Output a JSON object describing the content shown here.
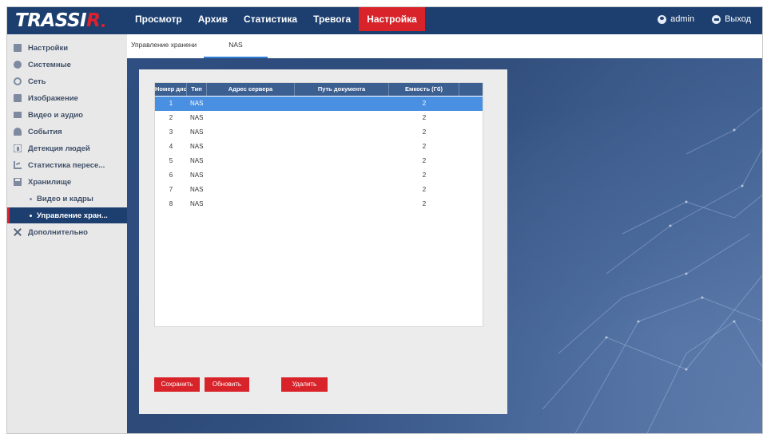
{
  "app": {
    "logo_main": "TRASSI",
    "logo_accent": "R"
  },
  "nav": {
    "items": [
      {
        "label": "Просмотр"
      },
      {
        "label": "Архив"
      },
      {
        "label": "Статистика"
      },
      {
        "label": "Тревога"
      },
      {
        "label": "Настройка",
        "active": true
      }
    ],
    "user": "admin",
    "logout": "Выход"
  },
  "sidebar": {
    "items": [
      {
        "label": "Настройки",
        "icon": "settings-icon"
      },
      {
        "label": "Системные",
        "icon": "system-icon"
      },
      {
        "label": "Сеть",
        "icon": "network-icon"
      },
      {
        "label": "Изображение",
        "icon": "image-icon"
      },
      {
        "label": "Видео и аудио",
        "icon": "video-audio-icon"
      },
      {
        "label": "События",
        "icon": "events-icon"
      },
      {
        "label": "Детекция людей",
        "icon": "people-detection-icon"
      },
      {
        "label": "Статистика пересе...",
        "icon": "statistics-icon"
      },
      {
        "label": "Хранилище",
        "icon": "storage-icon"
      },
      {
        "label": "Видео и кадры",
        "sub": true
      },
      {
        "label": "Управление хран...",
        "sub": true,
        "active": true
      },
      {
        "label": "Дополнительно",
        "icon": "tools-icon"
      }
    ]
  },
  "tabs": [
    {
      "label": "Управление хранени"
    },
    {
      "label": "NAS",
      "active": true
    }
  ],
  "table": {
    "headers": [
      "Номер диска",
      "Тип",
      "Адрес сервера",
      "Путь документа",
      "Емкость (Гб)"
    ],
    "rows": [
      {
        "num": "1",
        "type": "NAS",
        "server": "",
        "path": "",
        "capacity": "2",
        "selected": true
      },
      {
        "num": "2",
        "type": "NAS",
        "server": "",
        "path": "",
        "capacity": "2"
      },
      {
        "num": "3",
        "type": "NAS",
        "server": "",
        "path": "",
        "capacity": "2"
      },
      {
        "num": "4",
        "type": "NAS",
        "server": "",
        "path": "",
        "capacity": "2"
      },
      {
        "num": "5",
        "type": "NAS",
        "server": "",
        "path": "",
        "capacity": "2"
      },
      {
        "num": "6",
        "type": "NAS",
        "server": "",
        "path": "",
        "capacity": "2"
      },
      {
        "num": "7",
        "type": "NAS",
        "server": "",
        "path": "",
        "capacity": "2"
      },
      {
        "num": "8",
        "type": "NAS",
        "server": "",
        "path": "",
        "capacity": "2"
      }
    ]
  },
  "buttons": {
    "save": "Сохранить",
    "refresh": "Обновить",
    "delete": "Удалить"
  },
  "colors": {
    "header_blue": "#1c3f70",
    "accent_red": "#d8232a",
    "selection_blue": "#4a90e2",
    "table_head": "#3c5f91"
  }
}
